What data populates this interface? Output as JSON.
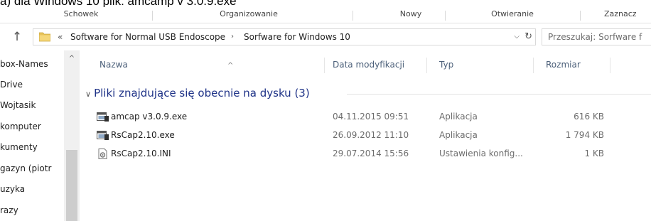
{
  "caption": "a) dla Windows 10 plik: amcamp v 3.0.9.exe",
  "ribbon": {
    "groups": [
      "Schowek",
      "Organizowanie",
      "Nowy",
      "Otwieranie",
      "Zaznacz"
    ]
  },
  "address": {
    "overflow": "«",
    "crumbs": [
      "Software for Normal USB Endoscope",
      "Sorfware for Windows 10"
    ],
    "separator": "›",
    "dropdown": "⌵",
    "refresh": "↻"
  },
  "search": {
    "placeholder": "Przeszukaj: Sorfware f"
  },
  "nav": {
    "items": [
      "box-Names",
      "Drive",
      "Wojtasik",
      "komputer",
      "kumenty",
      "gazyn (piotr",
      "uzyka",
      "razy"
    ]
  },
  "columns": {
    "name": "Nazwa",
    "modified": "Data modyfikacji",
    "type": "Typ",
    "size": "Rozmiar"
  },
  "group": {
    "label": "Pliki znajdujące się obecnie na dysku (3)"
  },
  "files": [
    {
      "name": "amcap v3.0.9.exe",
      "modified": "04.11.2015 09:51",
      "type": "Aplikacja",
      "size": "616 KB",
      "icon": "application-icon"
    },
    {
      "name": "RsCap2.10.exe",
      "modified": "26.09.2012 11:10",
      "type": "Aplikacja",
      "size": "1 794 KB",
      "icon": "application-icon"
    },
    {
      "name": "RsCap2.10.INI",
      "modified": "29.07.2014 15:56",
      "type": "Ustawienia konfig...",
      "size": "1 KB",
      "icon": "config-file-icon"
    }
  ],
  "colors": {
    "group_header": "#1e3287",
    "column_header": "#4c607a",
    "folder": "#e8c35a"
  }
}
